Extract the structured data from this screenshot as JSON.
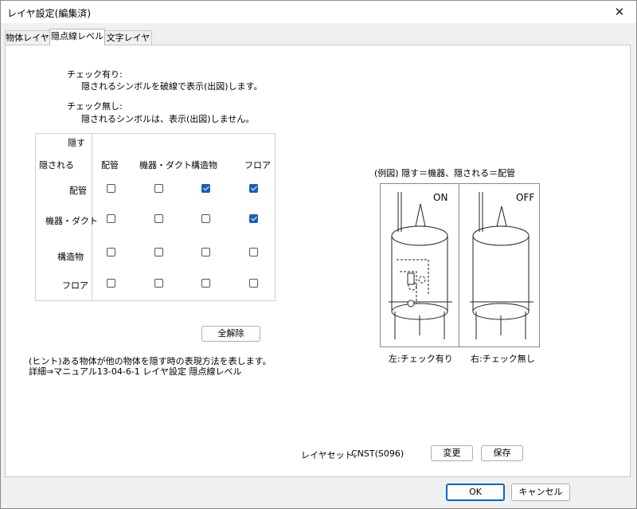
{
  "window": {
    "title": "レイヤ設定(編集済)"
  },
  "tabs": [
    {
      "label": "物体レイヤ"
    },
    {
      "label": "隠点線レベル"
    },
    {
      "label": "文字レイヤ"
    }
  ],
  "info": {
    "checked_title": "チェック有り:",
    "checked_desc": "隠されるシンボルを破線で表示(出図)します。",
    "unchecked_title": "チェック無し:",
    "unchecked_desc": "隠されるシンボルは、表示(出図)しません。"
  },
  "grid": {
    "hide_label": "隠す",
    "hidden_label": "隠される",
    "columns": [
      "配管",
      "機器・ダクト",
      "構造物",
      "フロア"
    ],
    "rows": [
      {
        "label": "配管",
        "checks": [
          false,
          false,
          true,
          true
        ]
      },
      {
        "label": "機器・ダクト",
        "checks": [
          false,
          false,
          false,
          true
        ]
      },
      {
        "label": "構造物",
        "checks": [
          false,
          false,
          false,
          false
        ]
      },
      {
        "label": "フロア",
        "checks": [
          false,
          false,
          false,
          false
        ]
      }
    ]
  },
  "buttons": {
    "clear_all": "全解除",
    "change": "変更",
    "save": "保存",
    "ok": "OK",
    "cancel": "キャンセル"
  },
  "hint": {
    "line1": "(ヒント)ある物体が他の物体を隠す時の表現方法を表します。",
    "line2": "詳細⇒マニュアル13-04-6-1 レイヤ設定 隠点線レベル"
  },
  "example": {
    "title": "(例図)  隠す＝機器、隠される＝配管",
    "on_label": "ON",
    "off_label": "OFF",
    "left_caption": "左:チェック有り",
    "right_caption": "右:チェック無し"
  },
  "layerset": {
    "label": "レイヤセット:",
    "value": "CNST(S096)"
  },
  "colors": {
    "accent": "#1a5fb4",
    "ok_border": "#0067c0"
  }
}
